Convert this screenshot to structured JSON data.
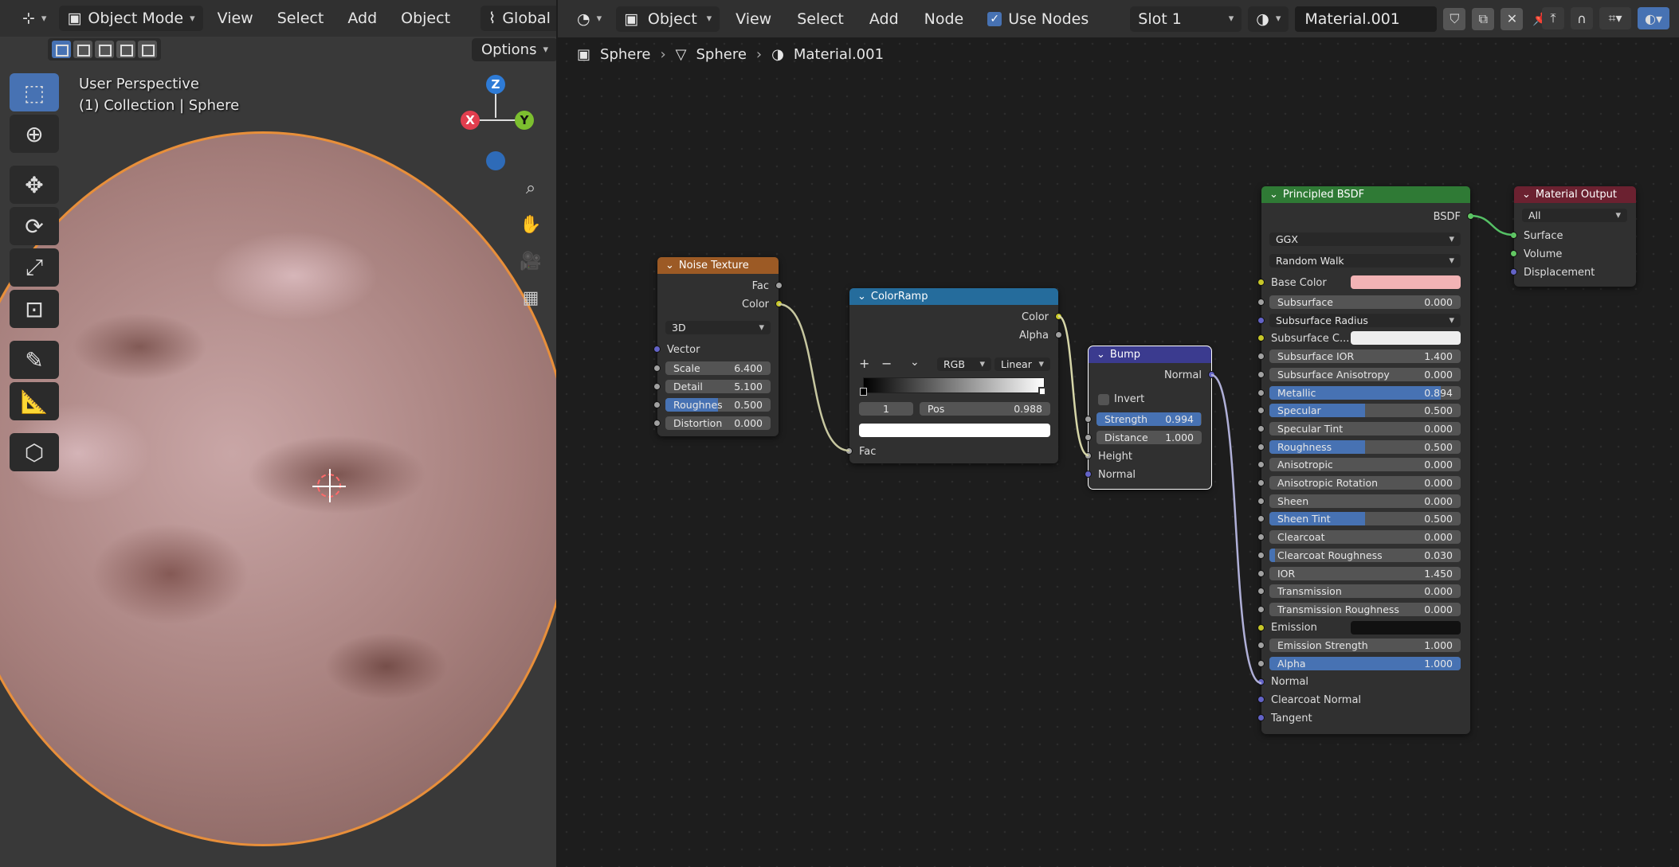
{
  "viewport": {
    "mode": "Object Mode",
    "menus": [
      "View",
      "Select",
      "Add",
      "Object"
    ],
    "orientation": "Global",
    "options_label": "Options",
    "info_line1": "User Perspective",
    "info_line2": "(1) Collection | Sphere",
    "gizmo": {
      "z": "Z",
      "x": "X",
      "y": "Y"
    }
  },
  "node_editor": {
    "type_label": "Object",
    "menus": [
      "View",
      "Select",
      "Add",
      "Node"
    ],
    "use_nodes_label": "Use Nodes",
    "use_nodes_checked": true,
    "slot": "Slot 1",
    "material_name": "Material.001",
    "breadcrumb": [
      "Sphere",
      "Sphere",
      "Material.001"
    ]
  },
  "nodes": {
    "noise": {
      "title": "Noise Texture",
      "out_fac": "Fac",
      "out_color": "Color",
      "dimensions": "3D",
      "in_vector": "Vector",
      "scale_label": "Scale",
      "scale_value": "6.400",
      "detail_label": "Detail",
      "detail_value": "5.100",
      "roughness_label": "Roughnes",
      "roughness_value": "0.500",
      "roughness_fraction": 0.5,
      "distortion_label": "Distortion",
      "distortion_value": "0.000"
    },
    "colorramp": {
      "title": "ColorRamp",
      "out_color": "Color",
      "out_alpha": "Alpha",
      "color_mode": "RGB",
      "interpolation": "Linear",
      "stop_index": "1",
      "pos_label": "Pos",
      "pos_value": "0.988",
      "in_fac": "Fac"
    },
    "bump": {
      "title": "Bump",
      "out_normal": "Normal",
      "invert_label": "Invert",
      "strength_label": "Strength",
      "strength_value": "0.994",
      "strength_fraction": 0.994,
      "distance_label": "Distance",
      "distance_value": "1.000",
      "in_height": "Height",
      "in_normal": "Normal"
    },
    "bsdf": {
      "title": "Principled BSDF",
      "out_bsdf": "BSDF",
      "distribution": "GGX",
      "subsurface_method": "Random Walk",
      "base_color_label": "Base Color",
      "base_color": "#f2b3b5",
      "subsurface_color_label": "Subsurface C...",
      "subsurface_radius_label": "Subsurface Radius",
      "emission_label": "Emission",
      "normal_label": "Normal",
      "clearcoat_normal_label": "Clearcoat Normal",
      "tangent_label": "Tangent",
      "params": [
        {
          "label": "Subsurface",
          "value": "0.000",
          "fraction": 0
        },
        {
          "label": "Subsurface IOR",
          "value": "1.400",
          "fraction": 0
        },
        {
          "label": "Subsurface Anisotropy",
          "value": "0.000",
          "fraction": 0
        },
        {
          "label": "Metallic",
          "value": "0.894",
          "fraction": 0.894
        },
        {
          "label": "Specular",
          "value": "0.500",
          "fraction": 0.5
        },
        {
          "label": "Specular Tint",
          "value": "0.000",
          "fraction": 0
        },
        {
          "label": "Roughness",
          "value": "0.500",
          "fraction": 0.5
        },
        {
          "label": "Anisotropic",
          "value": "0.000",
          "fraction": 0
        },
        {
          "label": "Anisotropic Rotation",
          "value": "0.000",
          "fraction": 0
        },
        {
          "label": "Sheen",
          "value": "0.000",
          "fraction": 0
        },
        {
          "label": "Sheen Tint",
          "value": "0.500",
          "fraction": 0.5
        },
        {
          "label": "Clearcoat",
          "value": "0.000",
          "fraction": 0
        },
        {
          "label": "Clearcoat Roughness",
          "value": "0.030",
          "fraction": 0.03
        },
        {
          "label": "IOR",
          "value": "1.450",
          "fraction": 0
        },
        {
          "label": "Transmission",
          "value": "0.000",
          "fraction": 0
        },
        {
          "label": "Transmission Roughness",
          "value": "0.000",
          "fraction": 0
        },
        {
          "label": "Emission Strength",
          "value": "1.000",
          "fraction": 0
        },
        {
          "label": "Alpha",
          "value": "1.000",
          "fraction": 1
        }
      ]
    },
    "output": {
      "title": "Material Output",
      "target": "All",
      "in_surface": "Surface",
      "in_volume": "Volume",
      "in_displacement": "Displacement"
    }
  }
}
